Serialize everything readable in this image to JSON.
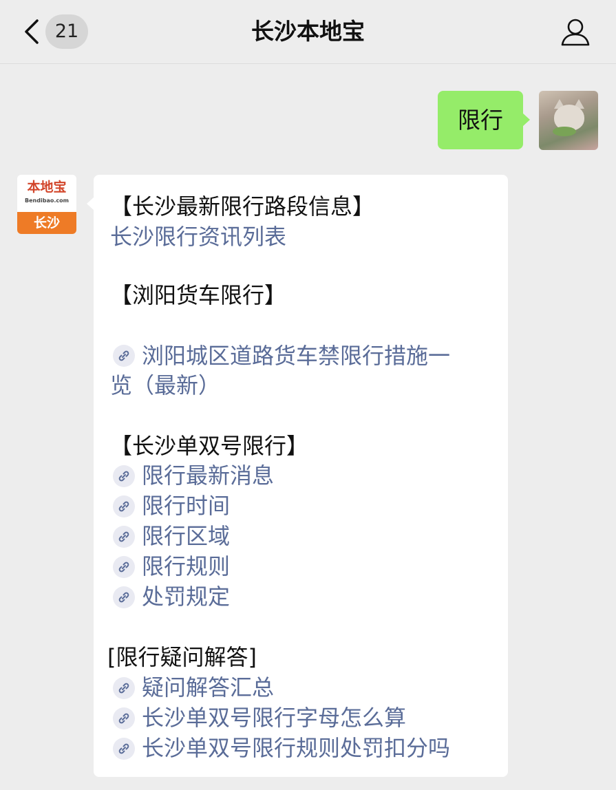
{
  "header": {
    "unread_count": "21",
    "title": "长沙本地宝"
  },
  "outgoing": {
    "text": "限行"
  },
  "official_logo": {
    "name": "本地宝",
    "domain": "Bendibao.com",
    "city": "长沙"
  },
  "message": {
    "section1_heading": "【长沙最新限行路段信息】",
    "section1_link": "长沙限行资讯列表",
    "section2_heading": "【浏阳货车限行】",
    "section2_link_line1": "浏阳城区道路货车禁限行措施一",
    "section2_link_line2": "览（最新）",
    "section3_heading": "【长沙单双号限行】",
    "section3_links": [
      "限行最新消息",
      "限行时间",
      "限行区域",
      "限行规则",
      "处罚规定"
    ],
    "section4_heading": "[限行疑问解答]",
    "section4_links": [
      "疑问解答汇总",
      "长沙单双号限行字母怎么算",
      "长沙单双号限行规则处罚扣分吗"
    ]
  },
  "colors": {
    "link": "#5a6c98",
    "outgoing_bubble": "#95ec69",
    "background": "#ededed"
  },
  "icons": [
    "chevron-left-icon",
    "person-icon",
    "link-icon"
  ]
}
